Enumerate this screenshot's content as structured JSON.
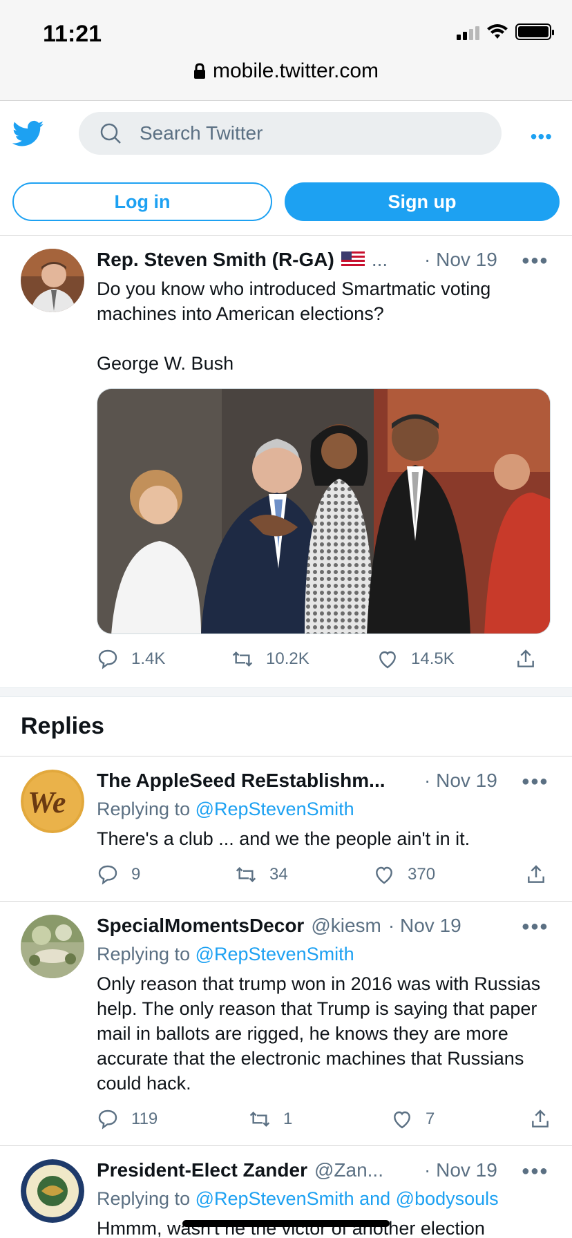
{
  "status_bar": {
    "time": "11:21"
  },
  "browser": {
    "url": "mobile.twitter.com"
  },
  "header": {
    "search_placeholder": "Search Twitter",
    "more_label": "•••",
    "login_label": "Log in",
    "signup_label": "Sign up"
  },
  "main_tweet": {
    "name": "Rep. Steven Smith (R-GA)",
    "handle_ellipsis": "...",
    "date": "· Nov 19",
    "text_line1": "Do you know who introduced Smartmatic voting machines into American elections?",
    "text_line2": "George W. Bush",
    "replies": "1.4K",
    "retweets": "10.2K",
    "likes": "14.5K"
  },
  "replies_title": "Replies",
  "replies": [
    {
      "name": "The AppleSeed ReEstablishm...",
      "handle": "",
      "date": "· Nov 19",
      "replying_prefix": "Replying to ",
      "replying_to": "@RepStevenSmith",
      "text": "There's a club ... and we the people ain't in it.",
      "replies": "9",
      "retweets": "34",
      "likes": "370"
    },
    {
      "name": "SpecialMomentsDecor",
      "handle": "@kiesm",
      "date": "· Nov 19",
      "replying_prefix": "Replying to ",
      "replying_to": "@RepStevenSmith",
      "text": "Only reason that trump won in 2016 was with Russias help. The only reason that Trump is saying that paper mail in ballots are rigged, he knows they are more accurate that the electronic machines that Russians could hack.",
      "replies": "119",
      "retweets": "1",
      "likes": "7"
    },
    {
      "name": "President-Elect Zander",
      "handle": "@Zan...",
      "date": "· Nov 19",
      "replying_prefix": "Replying to ",
      "replying_to": "@RepStevenSmith and @bodysouls",
      "text": "Hmmm, wasn't he the victor of another election"
    }
  ],
  "colors": {
    "accent": "#1da1f2",
    "secondary_text": "#5b7083"
  }
}
